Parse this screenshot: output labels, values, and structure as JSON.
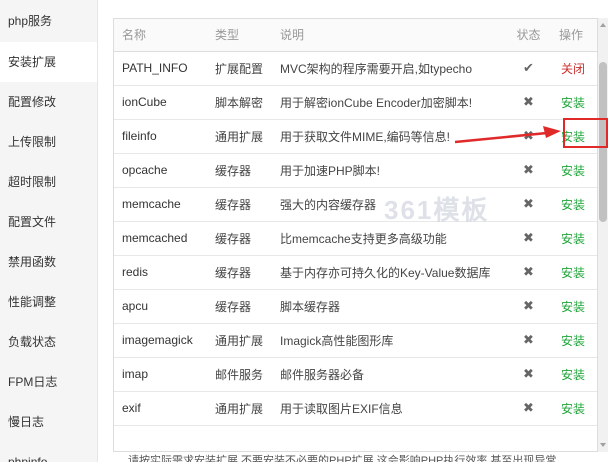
{
  "sidebar": {
    "items": [
      {
        "label": "php服务",
        "active": false
      },
      {
        "label": "安装扩展",
        "active": true
      },
      {
        "label": "配置修改",
        "active": false
      },
      {
        "label": "上传限制",
        "active": false
      },
      {
        "label": "超时限制",
        "active": false
      },
      {
        "label": "配置文件",
        "active": false
      },
      {
        "label": "禁用函数",
        "active": false
      },
      {
        "label": "性能调整",
        "active": false
      },
      {
        "label": "负载状态",
        "active": false
      },
      {
        "label": "FPM日志",
        "active": false
      },
      {
        "label": "慢日志",
        "active": false
      },
      {
        "label": "phpinfo",
        "active": false
      }
    ]
  },
  "table": {
    "headers": {
      "name": "名称",
      "type": "类型",
      "desc": "说明",
      "status": "状态",
      "action": "操作"
    },
    "rows": [
      {
        "name": "PATH_INFO",
        "type": "扩展配置",
        "desc": "MVC架构的程序需要开启,如typecho",
        "status": "✔",
        "action": "关闭",
        "action_color": "#c9302c"
      },
      {
        "name": "ionCube",
        "type": "脚本解密",
        "desc": "用于解密ionCube Encoder加密脚本!",
        "status": "✖",
        "action": "安装",
        "action_color": "#20a53a"
      },
      {
        "name": "fileinfo",
        "type": "通用扩展",
        "desc": "用于获取文件MIME,编码等信息!",
        "status": "✖",
        "action": "安装",
        "action_color": "#20a53a"
      },
      {
        "name": "opcache",
        "type": "缓存器",
        "desc": "用于加速PHP脚本!",
        "status": "✖",
        "action": "安装",
        "action_color": "#20a53a"
      },
      {
        "name": "memcache",
        "type": "缓存器",
        "desc": "强大的内容缓存器",
        "status": "✖",
        "action": "安装",
        "action_color": "#20a53a"
      },
      {
        "name": "memcached",
        "type": "缓存器",
        "desc": "比memcache支持更多高级功能",
        "status": "✖",
        "action": "安装",
        "action_color": "#20a53a"
      },
      {
        "name": "redis",
        "type": "缓存器",
        "desc": "基于内存亦可持久化的Key-Value数据库",
        "status": "✖",
        "action": "安装",
        "action_color": "#20a53a"
      },
      {
        "name": "apcu",
        "type": "缓存器",
        "desc": "脚本缓存器",
        "status": "✖",
        "action": "安装",
        "action_color": "#20a53a"
      },
      {
        "name": "imagemagick",
        "type": "通用扩展",
        "desc": "Imagick高性能图形库",
        "status": "✖",
        "action": "安装",
        "action_color": "#20a53a"
      },
      {
        "name": "imap",
        "type": "邮件服务",
        "desc": "邮件服务器必备",
        "status": "✖",
        "action": "安装",
        "action_color": "#20a53a"
      },
      {
        "name": "exif",
        "type": "通用扩展",
        "desc": "用于读取图片EXIF信息",
        "status": "✖",
        "action": "安装",
        "action_color": "#20a53a"
      }
    ]
  },
  "footer_note": "请按实际需求安装扩展,不要安装不必要的PHP扩展,这会影响PHP执行效率,甚至出现异常",
  "watermark": "361模板",
  "colors": {
    "install": "#20a53a",
    "close": "#c9302c",
    "highlight": "#e02a2a"
  }
}
